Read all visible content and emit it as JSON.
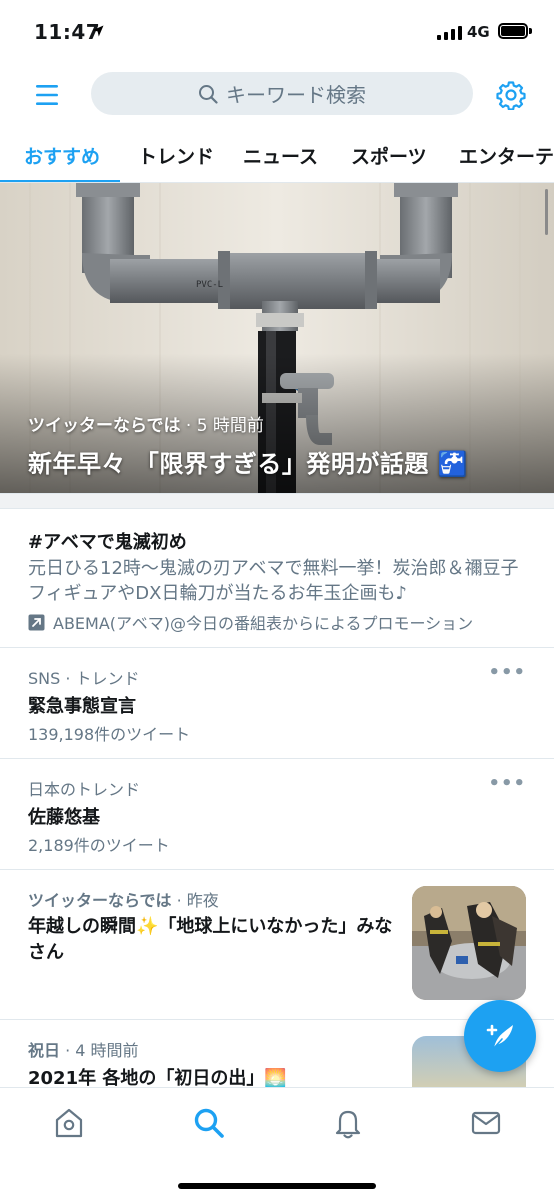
{
  "status_bar": {
    "time": "11:47",
    "network": "4G"
  },
  "search": {
    "placeholder": "キーワード検索"
  },
  "tabs": [
    {
      "label": "おすすめ",
      "active": true
    },
    {
      "label": "トレンド"
    },
    {
      "label": "ニュース"
    },
    {
      "label": "スポーツ"
    },
    {
      "label": "エンターテ"
    }
  ],
  "hero": {
    "source": "ツイッターならでは",
    "time": "· 5 時間前",
    "title": "新年早々 「限界すぎる」発明が話題 🚰"
  },
  "promoted": {
    "title": "#アベマで鬼滅初め",
    "description": "元日ひる12時〜鬼滅の刃アベマで無料一挙！炭治郎＆禰豆子フィギュアやDX日輪刀が当たるお年玉企画も♪",
    "promoted_by": "ABEMA(アベマ)@今日の番組表からによるプロモーション"
  },
  "trends": [
    {
      "context": "SNS · トレンド",
      "title": "緊急事態宣言",
      "count": "139,198件のツイート"
    },
    {
      "context": "日本のトレンド",
      "title": "佐藤悠基",
      "count": "2,189件のツイート"
    }
  ],
  "stories": [
    {
      "source": "ツイッターならでは",
      "time": "· 昨夜",
      "title": "年越しの瞬間✨「地球上にいなかった」みなさん"
    },
    {
      "source": "祝日",
      "time": "· 4 時間前",
      "title": "2021年 各地の「初日の出」🌅"
    }
  ],
  "colors": {
    "accent": "#1da1f2",
    "text": "#14171a",
    "secondary": "#657786",
    "border": "#e1e8ed"
  },
  "icons": {
    "header": [
      "menu-icon",
      "search-icon",
      "gear-icon"
    ],
    "bottom_nav": [
      "home-icon",
      "search-icon",
      "bell-icon",
      "mail-icon"
    ],
    "fab": "compose-tweet-icon"
  }
}
